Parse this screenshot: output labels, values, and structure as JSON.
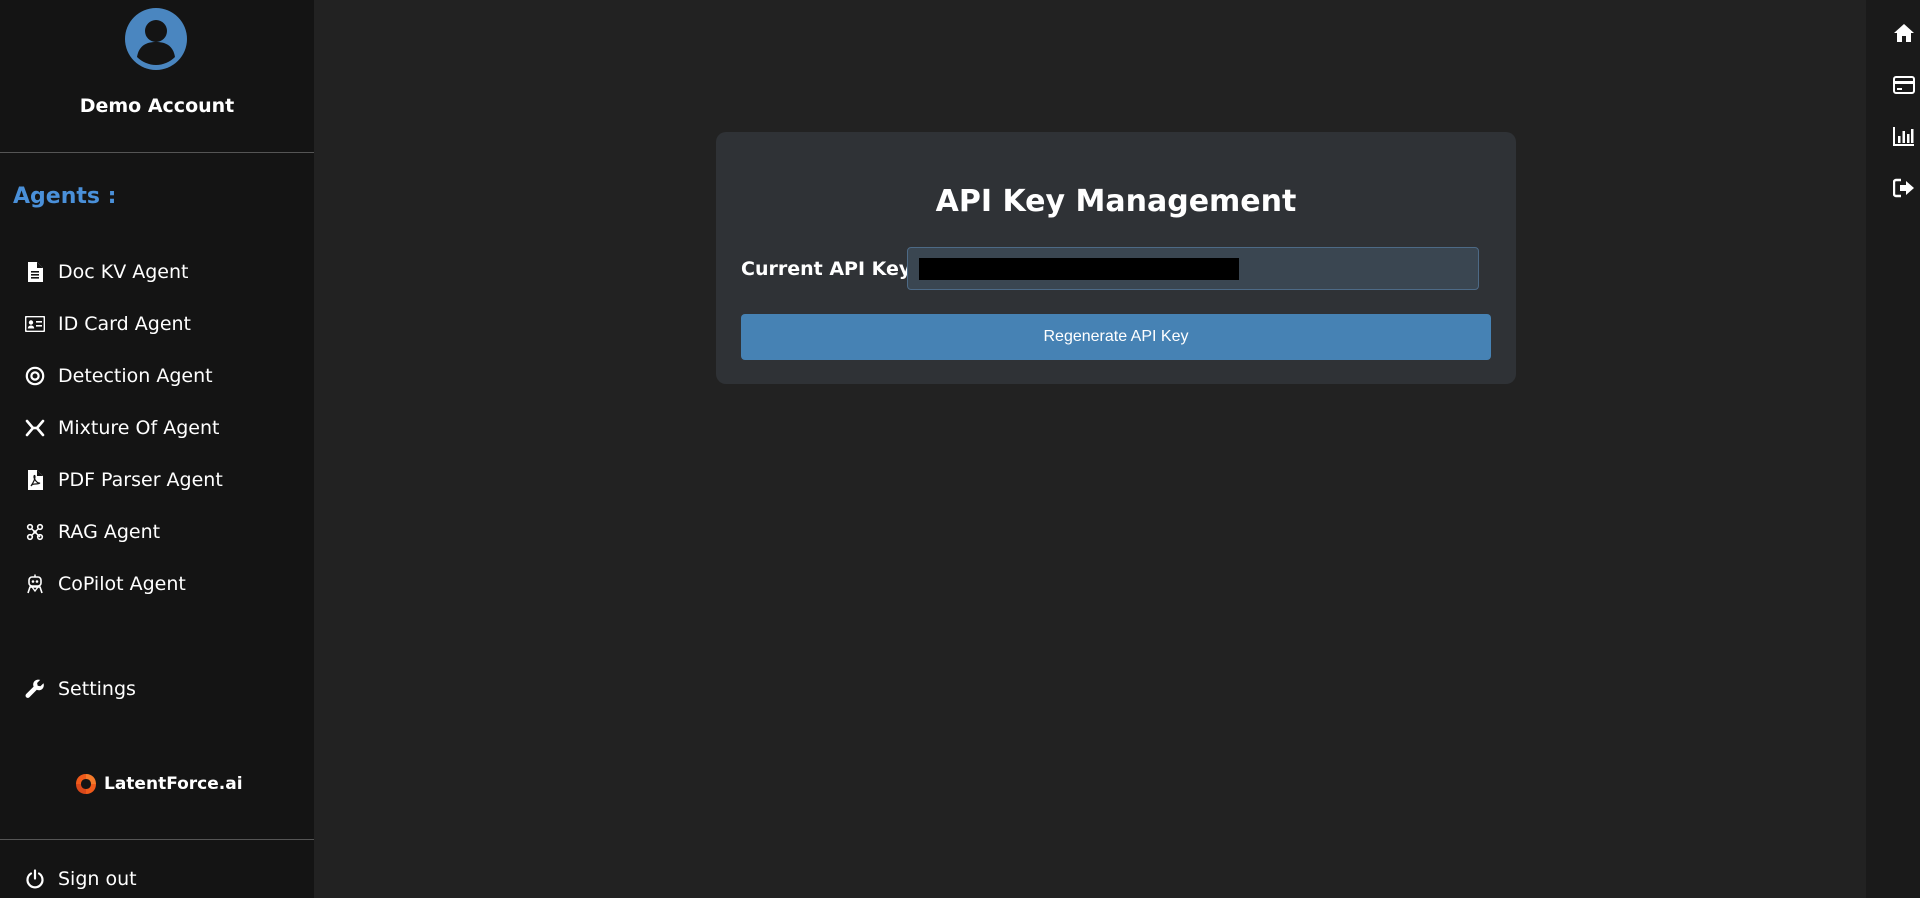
{
  "sidebar": {
    "account_name": "Demo Account",
    "agents_heading": "Agents :",
    "items": [
      {
        "label": "Doc KV Agent",
        "icon": "document-icon"
      },
      {
        "label": "ID Card Agent",
        "icon": "id-card-icon"
      },
      {
        "label": "Detection Agent",
        "icon": "target-icon"
      },
      {
        "label": "Mixture Of Agent",
        "icon": "merge-arrows-icon"
      },
      {
        "label": "PDF Parser Agent",
        "icon": "pdf-file-icon"
      },
      {
        "label": "RAG Agent",
        "icon": "graph-nodes-icon"
      },
      {
        "label": "CoPilot Agent",
        "icon": "robot-icon"
      }
    ],
    "settings_label": "Settings",
    "logo_text": "LatentForce.ai",
    "signout_label": "Sign out"
  },
  "right_rail": {
    "icons": [
      "home-icon",
      "credit-card-icon",
      "bar-chart-icon",
      "sign-out-icon"
    ]
  },
  "main": {
    "title": "API Key Management",
    "key_label": "Current API Key:",
    "regenerate_label": "Regenerate API Key"
  },
  "colors": {
    "accent": "#4a90d9",
    "button": "#4682b4",
    "logo": "#f05a1a"
  }
}
